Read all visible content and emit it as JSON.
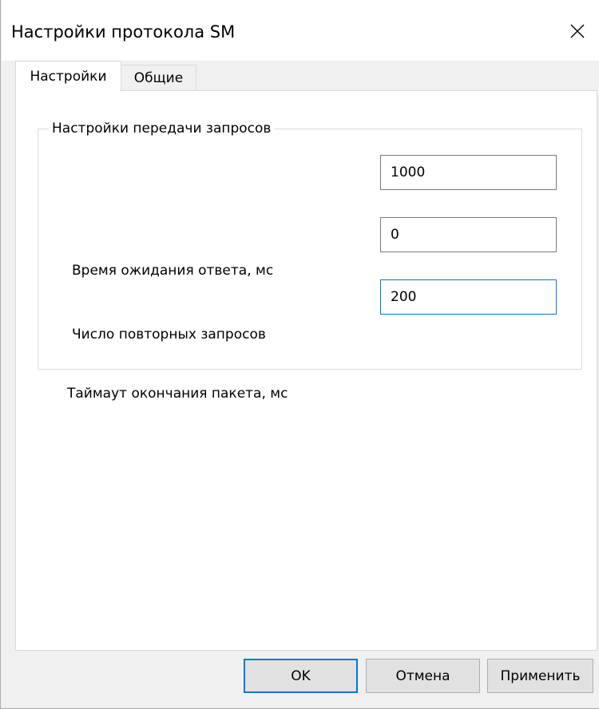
{
  "window": {
    "title": "Настройки протокола SM"
  },
  "tabs": [
    {
      "label": "Настройки",
      "active": true
    },
    {
      "label": "Общие",
      "active": false
    }
  ],
  "group": {
    "title": "Настройки передачи запросов",
    "fields": [
      {
        "label": "Время ожидания ответа, мс",
        "value": "1000"
      },
      {
        "label": "Число повторных запросов",
        "value": "0"
      },
      {
        "label": "Таймаут окончания пакета, мс",
        "value": "200"
      }
    ]
  },
  "buttons": {
    "ok": "OK",
    "cancel": "Отмена",
    "apply": "Применить"
  },
  "colors": {
    "accent": "#0078d7",
    "dialog_bg": "#f0f0f0",
    "panel_bg": "#ffffff"
  },
  "icons": {
    "close": "close-icon"
  }
}
